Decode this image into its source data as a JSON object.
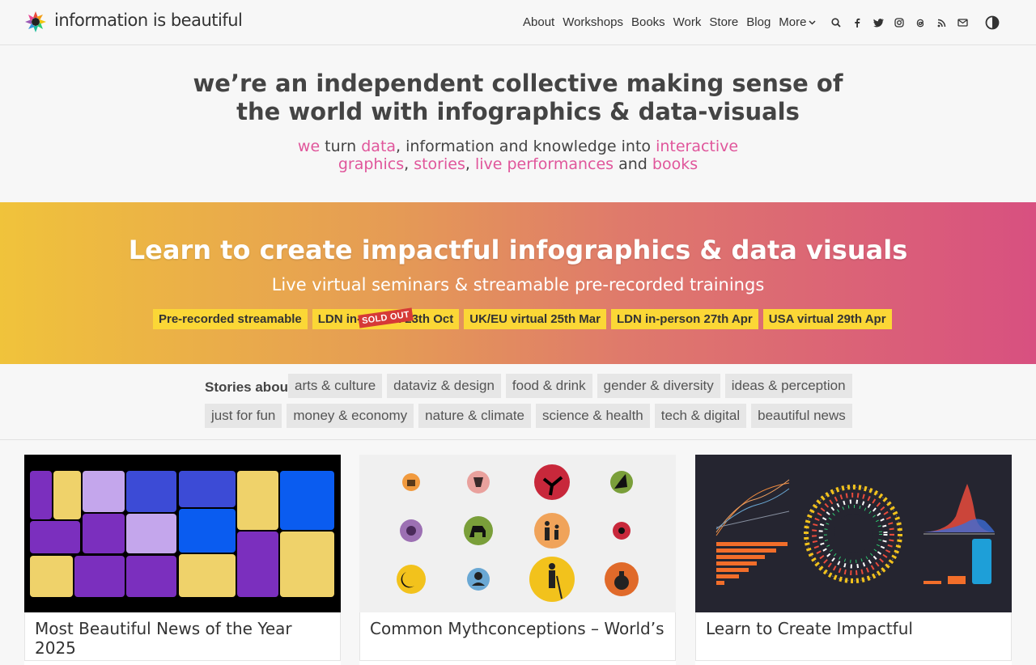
{
  "header": {
    "brand": "information is beautiful",
    "nav": [
      "About",
      "Workshops",
      "Books",
      "Work",
      "Store",
      "Blog"
    ],
    "more_label": "More",
    "icons": [
      "search-icon",
      "facebook-icon",
      "twitter-icon",
      "instagram-icon",
      "threads-icon",
      "rss-icon",
      "mail-icon"
    ],
    "theme_icon": "contrast-icon"
  },
  "intro": {
    "headline": "we’re an independent collective making sense of the world with infographics & data-visuals",
    "sub": {
      "we": "we",
      "turn": " turn ",
      "data": "data",
      "middle": ", information and knowledge into ",
      "interactive": "interactive graphics",
      "comma1": ", ",
      "stories": "stories",
      "comma2": ", ",
      "live": "live performances",
      "and": " and ",
      "books": "books"
    }
  },
  "banner": {
    "title": "Learn to create impactful infographics & data visuals",
    "tagline": "Live virtual seminars & streamable pre-recorded trainings",
    "pills": [
      "Pre-recorded streamable",
      "LDN in-person 23th Oct",
      "UK/EU virtual 25th Mar",
      "LDN in-person 27th Apr",
      "USA virtual 29th Apr"
    ],
    "sold_out": "SOLD OUT",
    "colors": {
      "start": "#f0c33b",
      "end": "#d85080",
      "pill": "#fbd736"
    }
  },
  "stories": {
    "label": "Stories about",
    "row1": [
      "arts & culture",
      "dataviz & design",
      "food & drink",
      "gender & diversity",
      "ideas & perception"
    ],
    "row2": [
      "just for fun",
      "money & economy",
      "nature & climate",
      "science & health",
      "tech & digital",
      "beautiful news"
    ]
  },
  "cards": [
    {
      "title": "Most Beautiful News of the Year 2025"
    },
    {
      "title": "Common Mythconceptions – World’s"
    },
    {
      "title": "Learn to Create Impactful"
    }
  ],
  "accent": "#e0569b"
}
